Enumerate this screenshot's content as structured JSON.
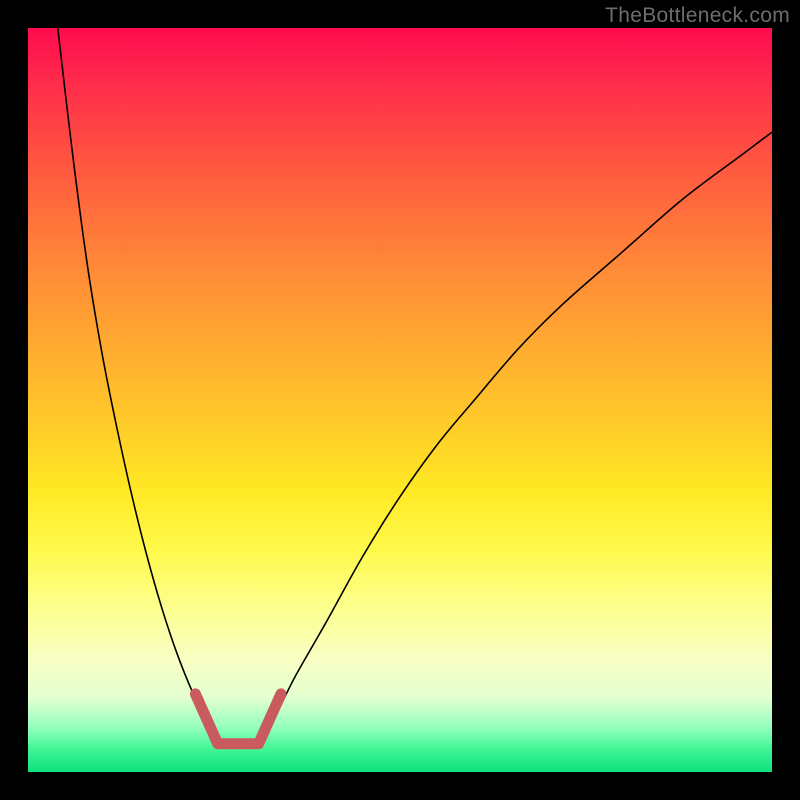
{
  "watermark": "TheBottleneck.com",
  "chart_data": {
    "type": "line",
    "title": "",
    "xlabel": "",
    "ylabel": "",
    "xlim": [
      0,
      100
    ],
    "ylim": [
      0,
      100
    ],
    "curve_left": {
      "x": [
        4,
        6,
        8,
        10,
        12,
        14,
        16,
        18,
        20,
        22,
        24,
        25,
        26
      ],
      "y": [
        100,
        83,
        68,
        56,
        46,
        37,
        29,
        22,
        16,
        11,
        7,
        5,
        4
      ]
    },
    "curve_right": {
      "x": [
        31,
        32,
        34,
        36,
        40,
        45,
        50,
        55,
        60,
        66,
        72,
        80,
        88,
        96,
        100
      ],
      "y": [
        4,
        5,
        9,
        13,
        20,
        29,
        37,
        44,
        50,
        57,
        63,
        70,
        77,
        83,
        86
      ]
    },
    "accent_segments": [
      {
        "x": [
          22.5,
          25.5
        ],
        "y": [
          10.5,
          3.8
        ]
      },
      {
        "x": [
          25.5,
          31.0
        ],
        "y": [
          3.8,
          3.8
        ]
      },
      {
        "x": [
          31.0,
          34.0
        ],
        "y": [
          3.8,
          10.5
        ]
      }
    ],
    "accent_color": "#c95b5f",
    "curve_color": "#000000",
    "background_gradient": [
      "#ff0b4f",
      "#ff7b3a",
      "#ffe824",
      "#0fe07e"
    ]
  }
}
